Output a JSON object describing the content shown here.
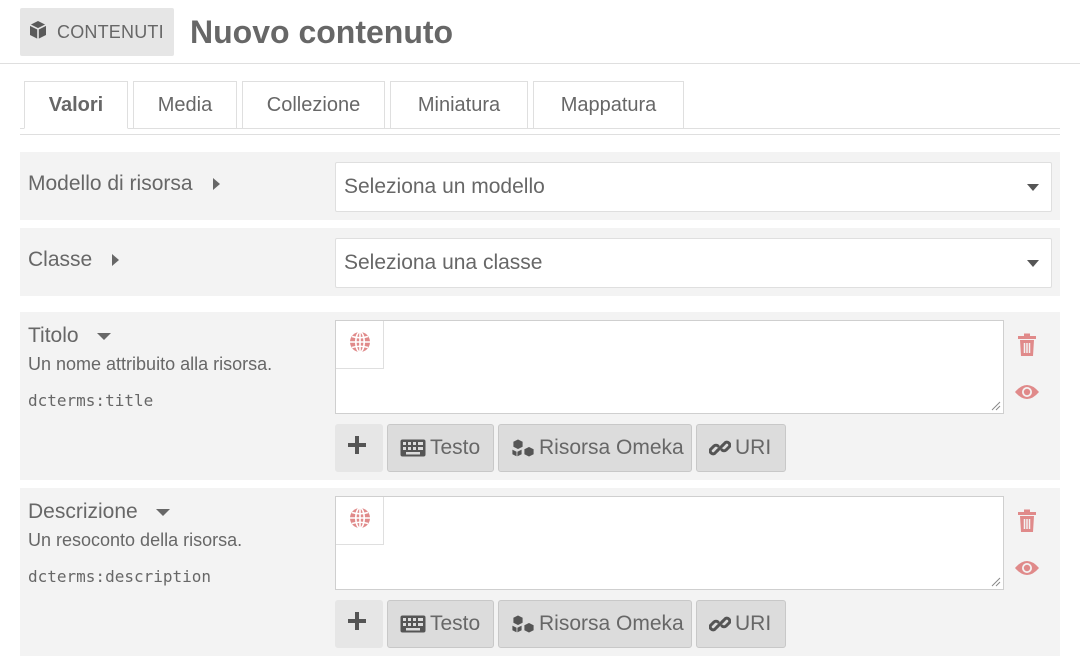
{
  "header": {
    "section_label": "CONTENUTI",
    "section_icon": "cube-icon",
    "title": "Nuovo contenuto"
  },
  "tabs": [
    {
      "label": "Valori",
      "active": true
    },
    {
      "label": "Media",
      "active": false
    },
    {
      "label": "Collezione",
      "active": false
    },
    {
      "label": "Miniatura",
      "active": false
    },
    {
      "label": "Mappatura",
      "active": false
    }
  ],
  "resource_template": {
    "label": "Modello di risorsa",
    "selected": "Seleziona un modello"
  },
  "resource_class": {
    "label": "Classe",
    "selected": "Seleziona una classe"
  },
  "properties": [
    {
      "label": "Titolo",
      "description": "Un nome attribuito alla risorsa.",
      "term": "dcterms:title",
      "value": ""
    },
    {
      "label": "Descrizione",
      "description": "Un resoconto della risorsa.",
      "term": "dcterms:description",
      "value": ""
    }
  ],
  "value_buttons": {
    "text_label": "Testo",
    "resource_label": "Risorsa Omeka",
    "uri_label": "URI"
  },
  "colors": {
    "accent_red": "#e08a8a",
    "panel_bg": "#f3f3f3",
    "text": "#676767"
  }
}
